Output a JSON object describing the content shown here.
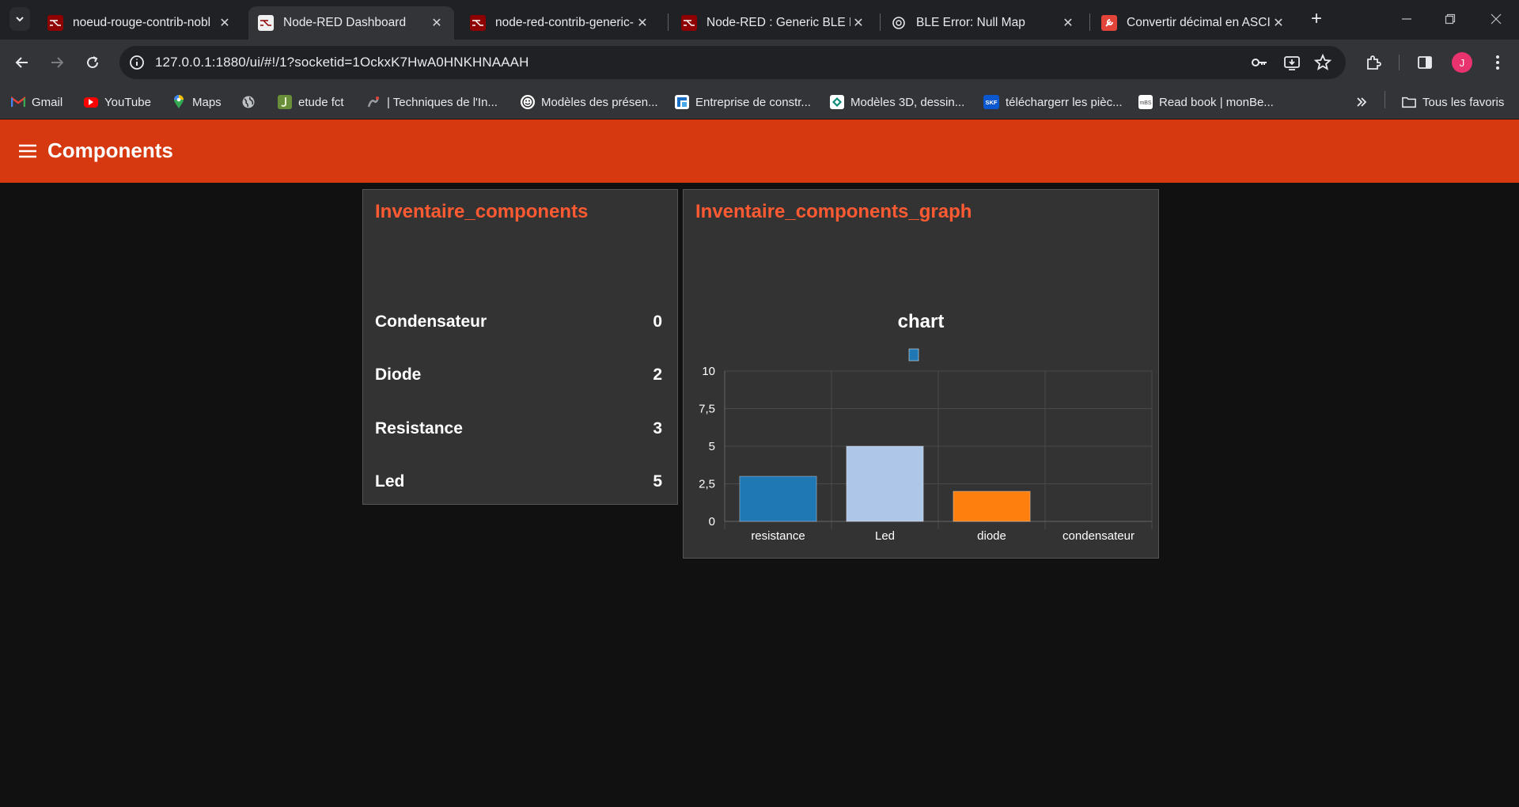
{
  "browser": {
    "tabs": [
      {
        "title": "noeud-rouge-contrib-nobl",
        "active": false
      },
      {
        "title": "Node-RED Dashboard",
        "active": true
      },
      {
        "title": "node-red-contrib-generic-",
        "active": false
      },
      {
        "title": "Node-RED : Generic BLE Ex",
        "active": false
      },
      {
        "title": "BLE Error: Null Map",
        "active": false
      },
      {
        "title": "Convertir décimal en ASCII",
        "active": false
      }
    ],
    "url": "127.0.0.1:1880/ui/#!/1?socketid=1OckxK7HwA0HNKHNAAAH",
    "profile_initial": "J",
    "bookmarks": [
      {
        "label": "Gmail",
        "icon": "gmail-icon"
      },
      {
        "label": "YouTube",
        "icon": "youtube-icon"
      },
      {
        "label": "Maps",
        "icon": "maps-icon"
      },
      {
        "label": "",
        "icon": "globe-icon"
      },
      {
        "label": "etude fct",
        "icon": "bookmark-icon"
      },
      {
        "label": "| Techniques de l'In...",
        "icon": "bookmark-icon"
      },
      {
        "label": "Modèles des présen...",
        "icon": "bookmark-icon"
      },
      {
        "label": "Entreprise de constr...",
        "icon": "bookmark-icon"
      },
      {
        "label": "Modèles 3D, dessin...",
        "icon": "bookmark-icon"
      },
      {
        "label": "téléchargerr les pièc...",
        "icon": "skf-icon"
      },
      {
        "label": "Read book | monBe...",
        "icon": "bookmark-icon"
      }
    ],
    "all_bookmarks_label": "Tous les favoris"
  },
  "dashboard": {
    "header_title": "Components",
    "accent_color": "#d6380f",
    "inventory_card": {
      "title": "Inventaire_components",
      "rows": [
        {
          "label": "Condensateur",
          "value": "0"
        },
        {
          "label": "Diode",
          "value": "2"
        },
        {
          "label": "Resistance",
          "value": "3"
        },
        {
          "label": "Led",
          "value": "5"
        }
      ]
    },
    "graph_card": {
      "title": "Inventaire_components_graph"
    }
  },
  "chart_data": {
    "type": "bar",
    "title": "chart",
    "categories": [
      "resistance",
      "Led",
      "diode",
      "condensateur"
    ],
    "values": [
      3,
      5,
      2,
      0
    ],
    "colors": [
      "#1f77b4",
      "#aec7e8",
      "#ff7f0e",
      "#ffbb78"
    ],
    "ylim": [
      0,
      10
    ],
    "yticks": [
      "0",
      "2,5",
      "5",
      "7,5",
      "10"
    ],
    "grid": true,
    "legend": "top-center"
  }
}
